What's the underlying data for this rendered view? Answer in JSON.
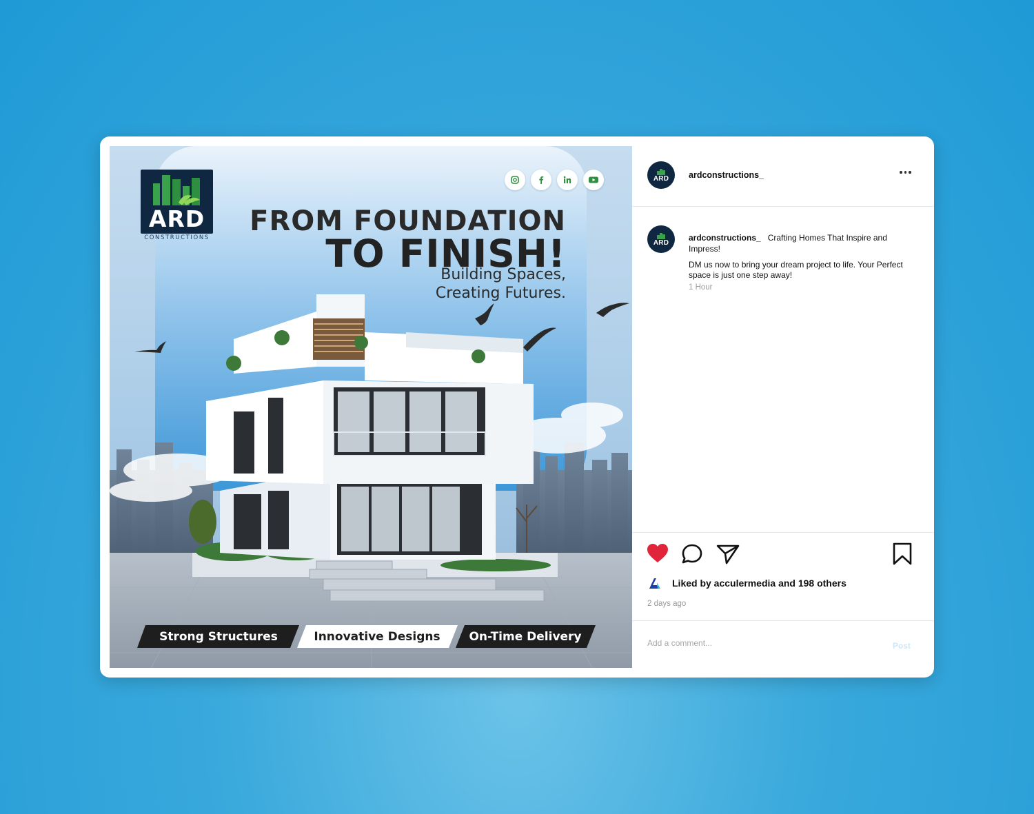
{
  "post": {
    "logo": {
      "brand": "ARD",
      "subtitle": "CONSTRUCTIONS"
    },
    "headline_line1": "FROM FOUNDATION",
    "headline_line2": "TO FINISH!",
    "subline1": "Building Spaces,",
    "subline2": "Creating Futures.",
    "social_icons": [
      "instagram-icon",
      "facebook-icon",
      "linkedin-icon",
      "youtube-icon"
    ],
    "tags": [
      "Strong Structures",
      "Innovative Designs",
      "On-Time Delivery"
    ]
  },
  "header": {
    "username": "ardconstructions_",
    "avatar_text": "ARD"
  },
  "caption": {
    "username": "ardconstructions_",
    "title": "Crafting Homes That Inspire and Impress!",
    "body": "DM us now to bring your dream project to life. Your Perfect space is just one step away!",
    "time": "1 Hour"
  },
  "actions": {
    "liked": true,
    "likes_text": "Liked by acculermedia and 198 others",
    "date": "2 days ago"
  },
  "comment": {
    "placeholder": "Add a comment...",
    "post_label": "Post"
  },
  "colors": {
    "background": "#2aa1da",
    "like": "#e0243a",
    "brand_navy": "#0f2740",
    "brand_green": "#3aa24a"
  }
}
